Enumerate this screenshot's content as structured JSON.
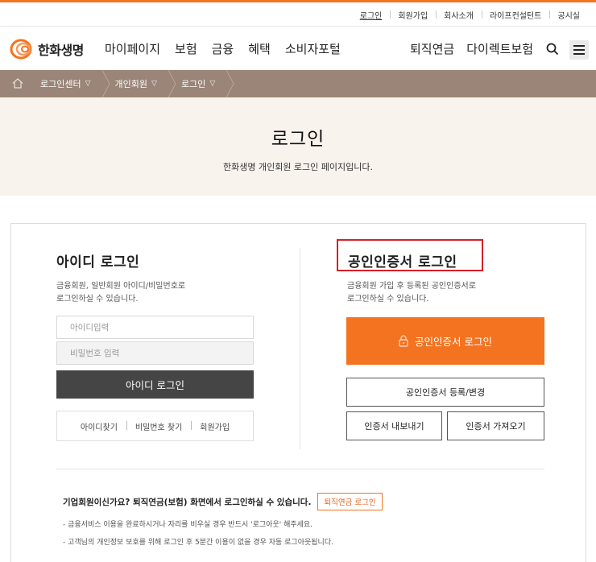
{
  "util_nav": [
    "로그인",
    "회원가입",
    "회사소개",
    "라이프컨설턴트",
    "공시실"
  ],
  "brand": {
    "name": "한화생명",
    "accent": "#f37321"
  },
  "menu": [
    "마이페이지",
    "보험",
    "금융",
    "혜택",
    "소비자포털"
  ],
  "menu_right": [
    "퇴직연금",
    "다이렉트보험"
  ],
  "icons": {
    "search": "search-icon",
    "menu": "hamburger-icon",
    "home": "home-icon",
    "lock": "lock-icon"
  },
  "breadcrumb": [
    "로그인센터",
    "개인회원",
    "로그인"
  ],
  "hero": {
    "title": "로그인",
    "subtitle": "한화생명 개인회원 로그인 페이지입니다."
  },
  "id_login": {
    "title": "아이디 로그인",
    "desc_1": "금융회원, 일반회원 아이디/비밀번호로",
    "desc_2": "로그인하실 수 있습니다.",
    "id_placeholder": "아이디입력",
    "pw_placeholder": "비밀번호 입력",
    "button": "아이디 로그인",
    "links": [
      "아이디찾기",
      "비밀번호 찾기",
      "회원가입"
    ]
  },
  "cert_login": {
    "title": "공인인증서 로그인",
    "desc_1": "금융회원 가입 후 등록된 공인인증서로",
    "desc_2": "로그인하실 수 있습니다.",
    "button": "공인인증서 로그인",
    "register": "공인인증서 등록/변경",
    "export": "인증서 내보내기",
    "import": "인증서 가져오기"
  },
  "corporate": {
    "text": "기업회원이신가요? 퇴직연금(보험) 화면에서 로그인하실 수 있습니다.",
    "button": "퇴직연금 로그인"
  },
  "notices": [
    "-  금융서비스 이용을 완료하시거나 자리를 비우실 경우 반드시 '로그아웃' 해주세요.",
    "-  고객님의 개인정보 보호를 위해 로그인 후 5분간 이용이 없을 경우 자동 로그아웃됩니다."
  ]
}
